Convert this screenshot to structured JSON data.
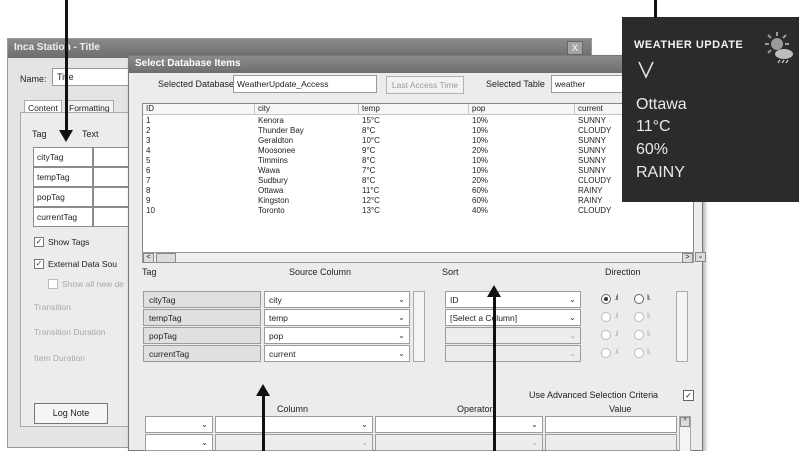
{
  "back_window": {
    "title": "Inca Station - Title",
    "close_label": "X",
    "name_label": "Name:",
    "name_value": "Title",
    "tabs": [
      "Content",
      "Formatting"
    ],
    "columns": {
      "tag": "Tag",
      "text": "Text"
    },
    "tag_rows": [
      "cityTag",
      "tempTag",
      "popTag",
      "currentTag"
    ],
    "show_tags_label": "Show Tags",
    "external_data_label": "External Data Sou",
    "show_all_new_label": "Show all new de",
    "transition_label": "Transition",
    "transition_duration_label": "Transition Duration",
    "item_duration_label": "Item Duration",
    "log_note_label": "Log Note"
  },
  "dialog": {
    "title": "Select Database Items",
    "selected_database_label": "Selected Database",
    "selected_database_value": "WeatherUpdate_Access",
    "last_access_label": "Last Access Time",
    "selected_table_label": "Selected Table",
    "selected_table_value": "weather",
    "grid": {
      "columns": [
        "ID",
        "city",
        "temp",
        "pop",
        "current"
      ],
      "rows": [
        [
          "1",
          "Kenora",
          "15°C",
          "10%",
          "SUNNY"
        ],
        [
          "2",
          "Thunder Bay",
          "8°C",
          "10%",
          "CLOUDY"
        ],
        [
          "3",
          "Geraldton",
          "10°C",
          "10%",
          "SUNNY"
        ],
        [
          "4",
          "Moosonee",
          "9°C",
          "20%",
          "SUNNY"
        ],
        [
          "5",
          "Timmins",
          "8°C",
          "10%",
          "SUNNY"
        ],
        [
          "6",
          "Wawa",
          "7°C",
          "10%",
          "SUNNY"
        ],
        [
          "7",
          "Sudbury",
          "8°C",
          "20%",
          "CLOUDY"
        ],
        [
          "8",
          "Ottawa",
          "11°C",
          "60%",
          "RAINY"
        ],
        [
          "9",
          "Kingston",
          "12°C",
          "60%",
          "RAINY"
        ],
        [
          "10",
          "Toronto",
          "13°C",
          "40%",
          "CLOUDY"
        ]
      ]
    },
    "mapping_headers": {
      "tag": "Tag",
      "source": "Source Column",
      "sort": "Sort",
      "direction": "Direction"
    },
    "mappings": [
      {
        "tag": "cityTag",
        "source": "city"
      },
      {
        "tag": "tempTag",
        "source": "temp"
      },
      {
        "tag": "popTag",
        "source": "pop"
      },
      {
        "tag": "currentTag",
        "source": "current"
      }
    ],
    "sort_values": [
      "ID",
      "[Select a Column]",
      "",
      ""
    ],
    "advanced_label": "Use Advanced Selection Criteria",
    "criteria_headers": {
      "column": "Column",
      "operator": "Operator",
      "value": "Value"
    }
  },
  "weather": {
    "title": "WEATHER UPDATE",
    "city": "Ottawa",
    "temp": "11°C",
    "pop": "60%",
    "current": "RAINY"
  },
  "icons": {
    "check": "✓",
    "dropdown": "⌄",
    "scroll_left": "<",
    "scroll_right": ">",
    "scroll_up": "^"
  }
}
